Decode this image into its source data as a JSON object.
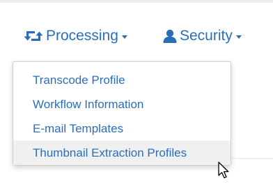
{
  "nav": {
    "processing": {
      "label": "Processing",
      "icon": "retweet-icon"
    },
    "security": {
      "label": "Security",
      "icon": "user-icon"
    }
  },
  "dropdown": {
    "items": [
      {
        "label": "Transcode Profile"
      },
      {
        "label": "Workflow Information"
      },
      {
        "label": "E-mail Templates"
      },
      {
        "label": "Thumbnail Extraction Profiles",
        "hovered": true
      }
    ]
  },
  "colors": {
    "link": "#2a6ebb",
    "hover_background": "#f0f0f0"
  }
}
